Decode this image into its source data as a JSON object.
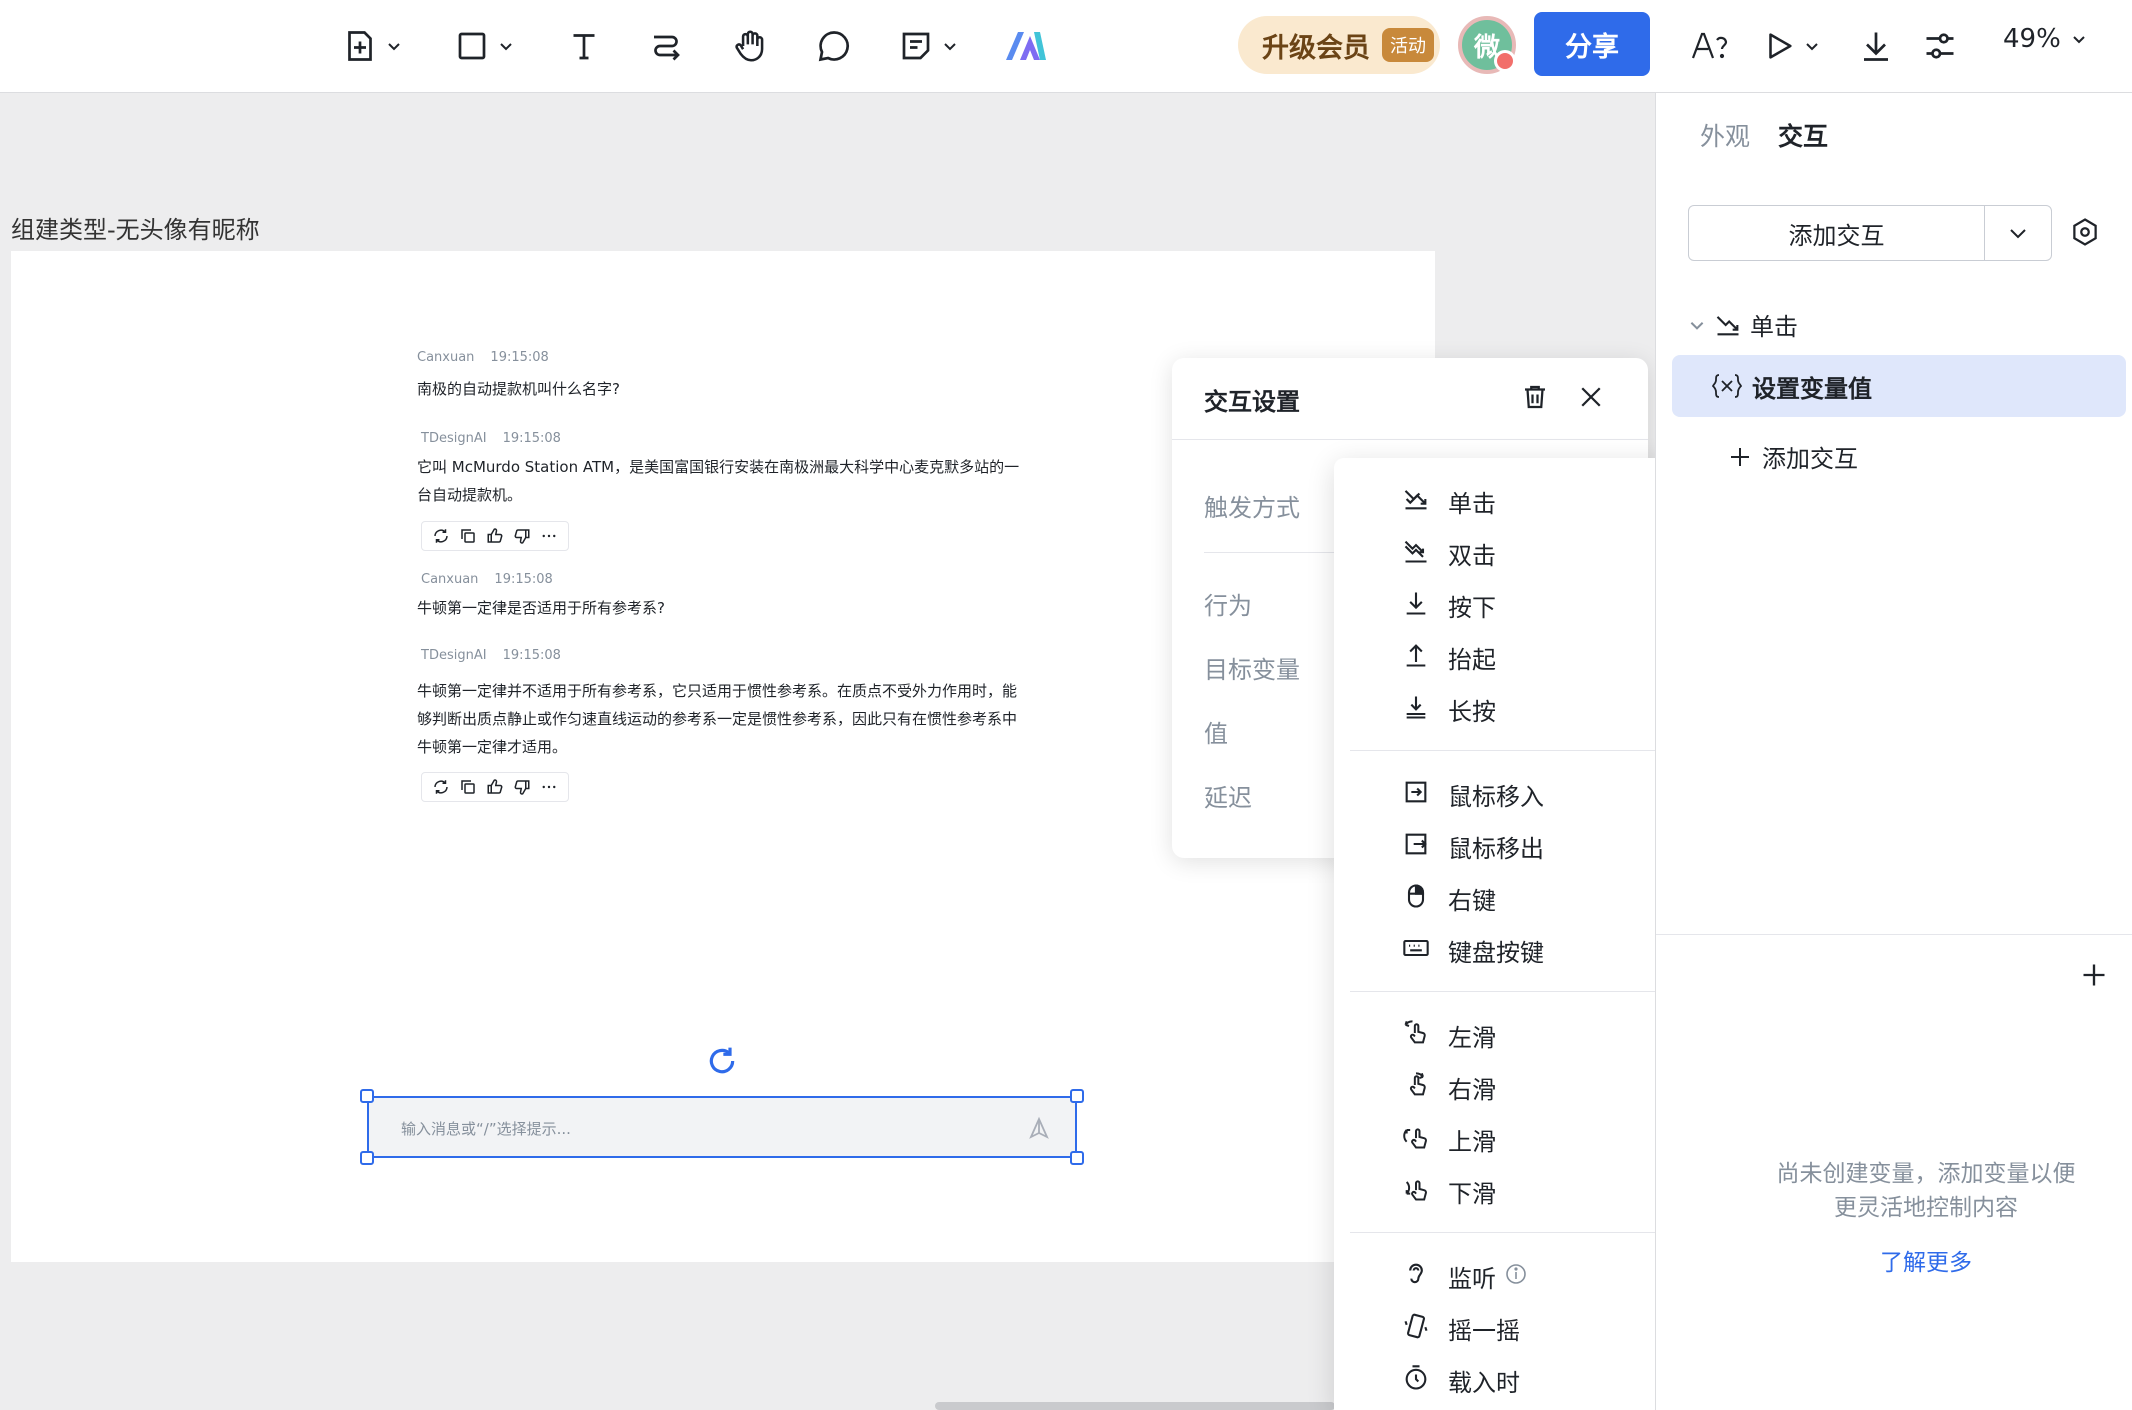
{
  "toolbar": {
    "upgrade_label": "升级会员",
    "upgrade_badge": "活动",
    "avatar_initial": "微",
    "share_label": "分享",
    "zoom_level": "49%"
  },
  "canvas": {
    "frame_label": "组建类型-无头像有昵称",
    "messages": [
      {
        "author": "Canxuan",
        "time": "19:15:08",
        "lines": [
          "南极的自动提款机叫什么名字?"
        ]
      },
      {
        "author": "TDesignAI",
        "time": "19:15:08",
        "lines": [
          "它叫 McMurdo Station ATM，是美国富国银行安装在南极洲最大科学中心麦克默多站的一",
          "台自动提款机。"
        ]
      },
      {
        "author": "Canxuan",
        "time": "19:15:08",
        "lines": [
          "牛顿第一定律是否适用于所有参考系?"
        ]
      },
      {
        "author": "TDesignAI",
        "time": "19:15:08",
        "lines": [
          "牛顿第一定律并不适用于所有参考系，它只适用于惯性参考系。在质点不受外力作用时，能",
          "够判断出质点静止或作匀速直线运动的参考系一定是惯性参考系，因此只有在惯性参考系中",
          "牛顿第一定律才适用。"
        ]
      }
    ],
    "input_placeholder": "输入消息或“/”选择提示..."
  },
  "settings_dialog": {
    "title": "交互设置",
    "labels": {
      "trigger": "触发方式",
      "action": "行为",
      "target_variable": "目标变量",
      "value": "值",
      "delay": "延迟"
    }
  },
  "trigger_dropdown": {
    "selected": "单击",
    "groups": [
      [
        {
          "label": "单击",
          "icon": "click-icon"
        },
        {
          "label": "双击",
          "icon": "double-click-icon"
        },
        {
          "label": "按下",
          "icon": "press-down-icon"
        },
        {
          "label": "抬起",
          "icon": "lift-up-icon"
        },
        {
          "label": "长按",
          "icon": "long-press-icon"
        }
      ],
      [
        {
          "label": "鼠标移入",
          "icon": "mouse-enter-icon"
        },
        {
          "label": "鼠标移出",
          "icon": "mouse-leave-icon"
        },
        {
          "label": "右键",
          "icon": "right-click-icon"
        },
        {
          "label": "键盘按键",
          "icon": "keyboard-icon"
        }
      ],
      [
        {
          "label": "左滑",
          "icon": "swipe-left-icon"
        },
        {
          "label": "右滑",
          "icon": "swipe-right-icon"
        },
        {
          "label": "上滑",
          "icon": "swipe-up-icon"
        },
        {
          "label": "下滑",
          "icon": "swipe-down-icon"
        }
      ],
      [
        {
          "label": "监听",
          "icon": "listen-icon"
        },
        {
          "label": "摇一摇",
          "icon": "shake-icon"
        },
        {
          "label": "载入时",
          "icon": "timer-icon"
        }
      ]
    ]
  },
  "right_panel": {
    "tabs": [
      "外观",
      "交互"
    ],
    "active_tab": "交互",
    "add_interaction_label": "添加交互",
    "trigger_label": "单击",
    "action_label": "设置变量值",
    "add_row_label": "添加交互",
    "empty_text_line1": "尚未创建变量，添加变量以便",
    "empty_text_line2": "更灵活地控制内容",
    "learn_more": "了解更多"
  },
  "colors": {
    "accent": "#2f6bea",
    "selected_row": "#dfe7fb",
    "upgrade_bg": "#fae9cf"
  }
}
